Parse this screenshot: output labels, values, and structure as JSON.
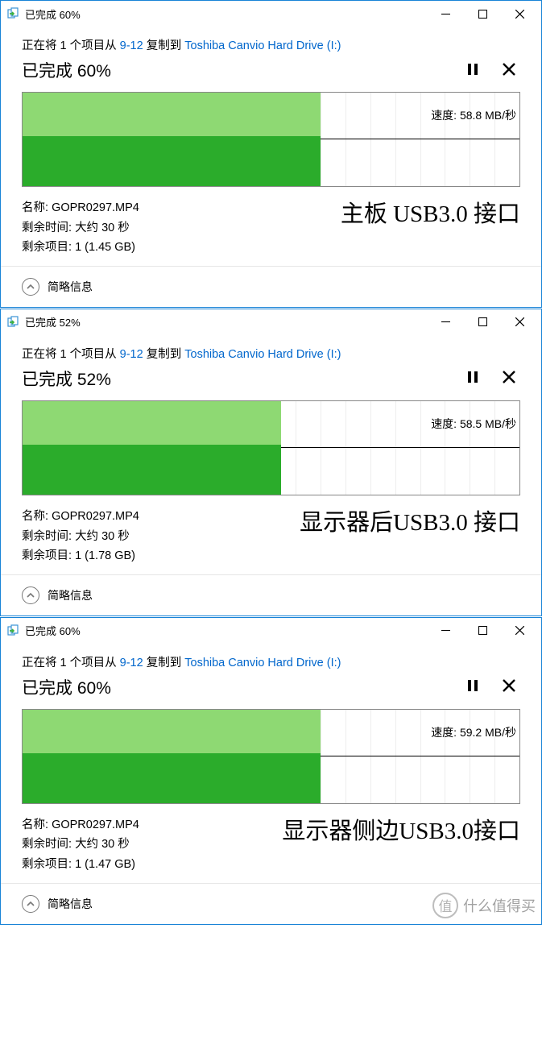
{
  "windows": [
    {
      "title": "已完成 60%",
      "copy_prefix": "正在将 1 个项目从 ",
      "copy_src": "9-12",
      "copy_mid": " 复制到 ",
      "copy_dest": "Toshiba Canvio Hard Drive (I:)",
      "status": "已完成 60%",
      "progress_pct": 60,
      "speed_label": "速度: 58.8 MB/秒",
      "name_label": "名称: ",
      "name_value": "GOPR0297.MP4",
      "time_label": "剩余时间: ",
      "time_value": "大约 30 秒",
      "remain_label": "剩余项目: ",
      "remain_value": "1 (1.45 GB)",
      "annotation": "主板 USB3.0 接口",
      "footer": "简略信息"
    },
    {
      "title": "已完成 52%",
      "copy_prefix": "正在将 1 个项目从 ",
      "copy_src": "9-12",
      "copy_mid": " 复制到 ",
      "copy_dest": "Toshiba Canvio Hard Drive (I:)",
      "status": "已完成 52%",
      "progress_pct": 52,
      "speed_label": "速度: 58.5 MB/秒",
      "name_label": "名称: ",
      "name_value": "GOPR0297.MP4",
      "time_label": "剩余时间: ",
      "time_value": "大约 30 秒",
      "remain_label": "剩余项目: ",
      "remain_value": "1 (1.78 GB)",
      "annotation": "显示器后USB3.0 接口",
      "footer": "简略信息"
    },
    {
      "title": "已完成 60%",
      "copy_prefix": "正在将 1 个项目从 ",
      "copy_src": "9-12",
      "copy_mid": " 复制到 ",
      "copy_dest": "Toshiba Canvio Hard Drive (I:)",
      "status": "已完成 60%",
      "progress_pct": 60,
      "speed_label": "速度: 59.2 MB/秒",
      "name_label": "名称: ",
      "name_value": "GOPR0297.MP4",
      "time_label": "剩余时间: ",
      "time_value": "大约 30 秒",
      "remain_label": "剩余项目: ",
      "remain_value": "1 (1.47 GB)",
      "annotation": "显示器侧边USB3.0接口",
      "footer": "简略信息"
    }
  ],
  "chart_data": [
    {
      "type": "area",
      "title": "文件复制速度",
      "xlabel": "",
      "ylabel": "MB/秒",
      "progress_pct": 60,
      "current_speed": 58.8,
      "ylim": [
        0,
        120
      ]
    },
    {
      "type": "area",
      "title": "文件复制速度",
      "xlabel": "",
      "ylabel": "MB/秒",
      "progress_pct": 52,
      "current_speed": 58.5,
      "ylim": [
        0,
        120
      ]
    },
    {
      "type": "area",
      "title": "文件复制速度",
      "xlabel": "",
      "ylabel": "MB/秒",
      "progress_pct": 60,
      "current_speed": 59.2,
      "ylim": [
        0,
        120
      ]
    }
  ],
  "watermark": {
    "text": "什么值得买",
    "badge": "值"
  }
}
